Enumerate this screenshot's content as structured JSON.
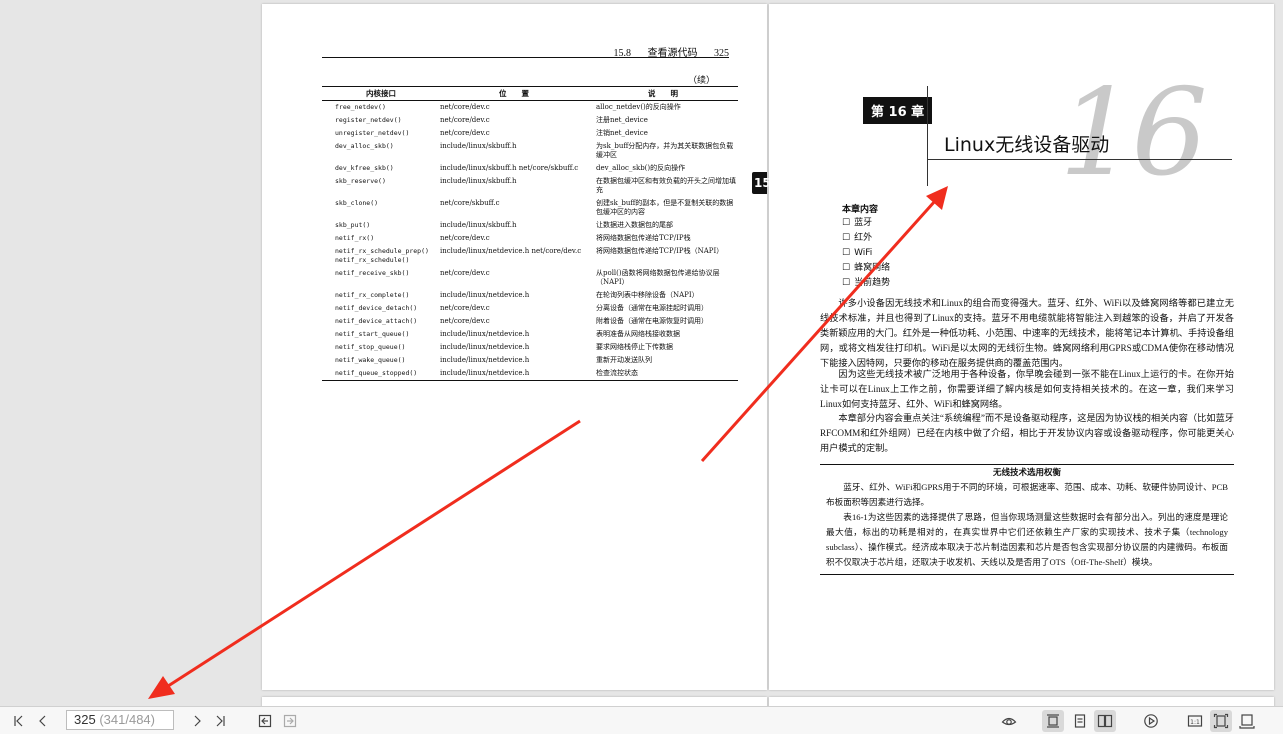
{
  "left_page": {
    "header": {
      "section": "15.8",
      "section_title": "查看源代码",
      "page_number": "325"
    },
    "continued": "（续）",
    "table": {
      "headers": [
        "内核接口",
        "位　　置",
        "说　　明"
      ],
      "rows": [
        {
          "fn": "free_netdev()",
          "loc": "net/core/dev.c",
          "desc": "alloc_netdev()的反向操作"
        },
        {
          "fn": "register_netdev()",
          "loc": "net/core/dev.c",
          "desc": "注册net_device"
        },
        {
          "fn": "unregister_netdev()",
          "loc": "net/core/dev.c",
          "desc": "注销net_device"
        },
        {
          "fn": "dev_alloc_skb()",
          "loc": "include/linux/skbuff.h",
          "desc": "为sk_buff分配内存，并为其关联数据包负载缓冲区"
        },
        {
          "fn": "dev_kfree_skb()",
          "loc": "include/linux/skbuff.h net/core/skbuff.c",
          "desc": "dev_alloc_skb()的反向操作"
        },
        {
          "fn": "skb_reserve()",
          "loc": "include/linux/skbuff.h",
          "desc": "在数据包缓冲区和有效负载的开头之间增加填充"
        },
        {
          "fn": "skb_clone()",
          "loc": "net/core/skbuff.c",
          "desc": "创建sk_buff的副本，但是不复制关联的数据包缓冲区的内容"
        },
        {
          "fn": "skb_put()",
          "loc": "include/linux/skbuff.h",
          "desc": "让数据进入数据包的尾部"
        },
        {
          "fn": "netif_rx()",
          "loc": "net/core/dev.c",
          "desc": "将网络数据包传递给TCP/IP栈"
        },
        {
          "fn": "netif_rx_schedule_prep() netif_rx_schedule()",
          "loc": "include/linux/netdevice.h net/core/dev.c",
          "desc": "将网络数据包传递给TCP/IP栈（NAPI）"
        },
        {
          "fn": "netif_receive_skb()",
          "loc": "net/core/dev.c",
          "desc": "从poll()函数将网络数据包传递给协议层（NAPI）"
        },
        {
          "fn": "netif_rx_complete()",
          "loc": "include/linux/netdevice.h",
          "desc": "在轮询列表中移除设备（NAPI）"
        },
        {
          "fn": "netif_device_detach()",
          "loc": "net/core/dev.c",
          "desc": "分离设备（通常在电源挂起时调用）"
        },
        {
          "fn": "netif_device_attach()",
          "loc": "net/core/dev.c",
          "desc": "附着设备（通常在电源恢复时调用）"
        },
        {
          "fn": "netif_start_queue()",
          "loc": "include/linux/netdevice.h",
          "desc": "表明准备从网络栈接收数据"
        },
        {
          "fn": "netif_stop_queue()",
          "loc": "include/linux/netdevice.h",
          "desc": "要求网络栈停止下传数据"
        },
        {
          "fn": "netif_wake_queue()",
          "loc": "include/linux/netdevice.h",
          "desc": "重新开动发送队列"
        },
        {
          "fn": "netif_queue_stopped()",
          "loc": "include/linux/netdevice.h",
          "desc": "检查流控状态"
        }
      ]
    },
    "side_tab": "15"
  },
  "right_page": {
    "chapter_badge": "第 16 章",
    "chapter_number": "16",
    "chapter_title": "Linux无线设备驱动",
    "toc_title": "本章内容",
    "toc_items": [
      "蓝牙",
      "红外",
      "WiFi",
      "蜂窝网络",
      "当前趋势"
    ],
    "paragraphs": [
      "许多小设备因无线技术和Linux的组合而变得强大。蓝牙、红外、WiFi以及蜂窝网络等都已建立无线技术标准，并且也得到了Linux的支持。蓝牙不用电缆就能将智能注入到越笨的设备，并启了开发各类新颖应用的大门。红外是一种低功耗、小范围、中速率的无线技术，能将笔记本计算机、手持设备组网，或将文档发往打印机。WiFi是以太网的无线衍生物。蜂窝网络利用GPRS或CDMA使你在移动情况下能接入因特网，只要你的移动在服务提供商的覆盖范围内。",
      "因为这些无线技术被广泛地用于各种设备，你早晚会碰到一张不能在Linux上运行的卡。在你开始让卡可以在Linux上工作之前，你需要详细了解内核是如何支持相关技术的。在这一章，我们来学习Linux如何支持蓝牙、红外、WiFi和蜂窝网络。",
      "本章部分内容会重点关注“系统编程”而不是设备驱动程序，这是因为协议栈的相关内容（比如蓝牙RFCOMM和红外组网）已经在内核中做了介绍，相比于开发协议内容或设备驱动程序，你可能更关心用户模式的定制。"
    ],
    "box": {
      "title": "无线技术选用权衡",
      "paragraphs": [
        "蓝牙、红外、WiFi和GPRS用于不同的环境，可根据速率、范围、成本、功耗、软硬件协同设计、PCB布板面积等因素进行选择。",
        "表16-1为这些因素的选择提供了思路，但当你现场测量这些数据时会有部分出入。列出的速度是理论最大值，标出的功耗是相对的，在真实世界中它们还依赖生产厂家的实现技术、技术子集（technology subclass）、操作模式。经济成本取决于芯片制造因素和芯片是否包含实现部分协议层的内建微码。布板面积不仅取决于芯片组，还取决于收发机、天线以及是否用了OTS（Off-The-Shelf）模块。"
      ]
    }
  },
  "toolbar": {
    "current_page": "325",
    "page_total": "(341/484)"
  },
  "colors": {
    "annotation_arrow": "#f02d1e",
    "toolbar_bg": "#f7f7f7",
    "viewer_bg": "#e6e6e6"
  }
}
